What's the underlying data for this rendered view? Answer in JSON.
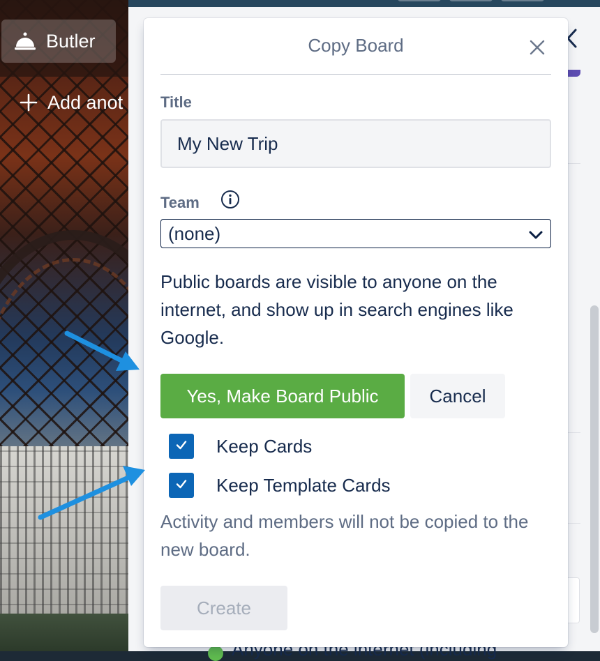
{
  "sidebar": {
    "butler_label": "Butler",
    "add_list_label": "Add anot"
  },
  "dialog": {
    "title": "Copy Board",
    "title_field": {
      "label": "Title",
      "value": "My New Trip"
    },
    "team_field": {
      "label": "Team",
      "selected": "(none)"
    },
    "public_notice": "Public boards are visible to anyone on the internet, and show up in search engines like Google.",
    "make_public_button": "Yes, Make Board Public",
    "cancel_button": "Cancel",
    "options": [
      {
        "label": "Keep Cards",
        "checked": true
      },
      {
        "label": "Keep Template Cards",
        "checked": true
      }
    ],
    "activity_notice": "Activity and members will not be copied to the new board.",
    "create_button": "Create"
  },
  "background_panel": {
    "partial_text": "Anyone on the internet (including"
  },
  "colors": {
    "primary_green": "#5aac44",
    "checkbox_blue": "#0c66b6",
    "annotation_arrow": "#1e90e0",
    "text_dark": "#172b4d",
    "text_muted": "#5e6c84"
  },
  "icons": {
    "butler": "bell-icon",
    "add": "plus-icon",
    "close": "close-icon",
    "team_info": "info-icon",
    "select": "chevron-down-icon",
    "check": "check-icon",
    "back": "chevron-left-icon"
  }
}
